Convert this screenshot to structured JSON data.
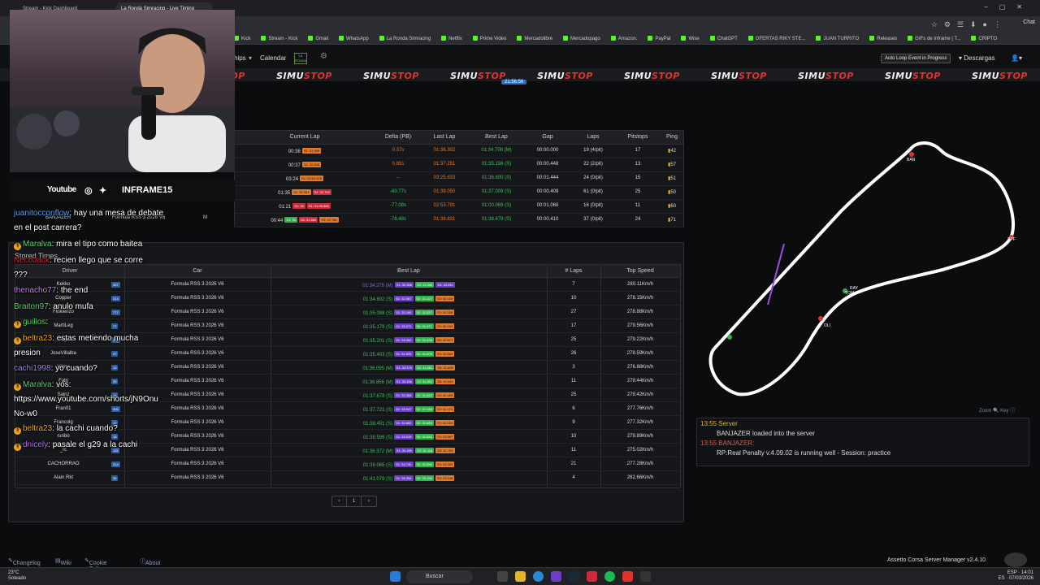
{
  "browser": {
    "tabs": [
      "Stream - Kick Dashboard",
      "La Ronda Simracing - Live Timing"
    ],
    "bookmarks": [
      "Kick",
      "Stream - Kick",
      "Gmail",
      "WhatsApp",
      "La Ronda Simracing",
      "Netflix",
      "Prime Video",
      "Mercadolibre",
      "Mercadopago",
      "Amazon.",
      "PayPal",
      "Wise",
      "ChatGPT",
      "OFERTAS RIKY STE...",
      "JUAN TURRITO",
      "Releases",
      "GIFs de Inframe | T...",
      "CRIPTO"
    ],
    "chat_label": "Chat"
  },
  "nav": {
    "partial_item": "hips",
    "calendar": "Calendar",
    "logo_text": "LA RONDA",
    "auto_loop": "Auto Loop Event in Progress",
    "downloads": "Descargas"
  },
  "sponsor": {
    "name_a": "SIMU",
    "name_b": "STOP"
  },
  "timer_chip": "21:56:56",
  "live_timing": {
    "headers": [
      "Current Lap",
      "Delta (PB)",
      "Last Lap",
      "Best Lap",
      "Gap",
      "Laps",
      "Pitstops",
      "Ping"
    ],
    "rows": [
      {
        "current": "00:36",
        "chips": [
          "S1: 31.598"
        ],
        "delta": "0.37s",
        "last": "01:36.302",
        "best": "01:34.708 (M)",
        "gap": "00:00.000",
        "laps": "19 (4/pit)",
        "pit": "17",
        "ping": "42"
      },
      {
        "current": "00:37",
        "chips": [
          "S1: 32.626"
        ],
        "delta": "0.65s",
        "last": "01:37.251",
        "best": "01:35.156 (S)",
        "gap": "00:00.448",
        "laps": "22 (2/pit)",
        "pit": "13",
        "ping": "57"
      },
      {
        "current": "03:24",
        "chips": [
          "S1: 03:03.926"
        ],
        "delta": "--",
        "last": "03:25.633",
        "best": "01:36.600 (S)",
        "gap": "00:01.444",
        "laps": "24 (0/pit)",
        "pit": "15",
        "ping": "51"
      },
      {
        "current": "01:35",
        "chips": [
          "S1: 30.333",
          "S2: 32.793"
        ],
        "delta": "-60.77s",
        "last": "01:39.050",
        "best": "01:37.009 (S)",
        "gap": "00:00.409",
        "laps": "61 (0/pit)",
        "pit": "25",
        "ping": "50"
      },
      {
        "current": "01:21",
        "chips": [
          "S1: 30",
          "S1: 01:00.606"
        ],
        "delta": "-77.08s",
        "last": "02:53.791",
        "best": "01:00.069 (S)",
        "gap": "00:01.060",
        "laps": "16 (0/pit)",
        "pit": "11",
        "ping": "60"
      },
      {
        "current": "00:44",
        "chips": [
          "S1: 30",
          "S2: 31.585",
          "S3: 42.786"
        ],
        "delta": "-78.48s",
        "last": "01:38.831",
        "best": "01:38.479 (S)",
        "gap": "00:00.410",
        "laps": "37 (0/pit)",
        "pit": "24",
        "ping": "71"
      }
    ],
    "left_partial": [
      {
        "driver": "BANJAZER",
        "car": "Formula RSS 3 2026 V6",
        "tyre": "M"
      }
    ]
  },
  "stored_times": {
    "title": "Stored Times",
    "headers": [
      "Driver",
      "Car",
      "Best Lap",
      "# Laps",
      "Top Speed"
    ],
    "rows": [
      {
        "driver": "Kekko",
        "num": "307",
        "car": "Formula RSS 3 2026 V6",
        "best": "01:34.276 (M)",
        "s": [
          "S1: 32.558",
          "S2: 31.065",
          "S3: 40.261"
        ],
        "laps": "7",
        "speed": "280.11Km/h"
      },
      {
        "driver": "Copper",
        "num": "314",
        "car": "Formula RSS 3 2026 V6",
        "best": "01:34.602 (S)",
        "s": [
          "S1: 32.987",
          "S2: 31.107",
          "S3: 40.428"
        ],
        "laps": "10",
        "speed": "278.15Km/h"
      },
      {
        "driver": "Flokienzo",
        "num": "777",
        "car": "Formula RSS 3 2026 V6",
        "best": "01:35.098 (S)",
        "s": [
          "S1: 33.195",
          "S2: 31.537",
          "S3: 40.336"
        ],
        "laps": "27",
        "speed": "278.88Km/h"
      },
      {
        "driver": "MartiLeg",
        "num": "77",
        "car": "Formula RSS 3 2026 V6",
        "best": "01:35.179 (S)",
        "s": [
          "S1: 33.071",
          "S2: 31.471",
          "S3: 40.433"
        ],
        "laps": "17",
        "speed": "279.56Km/h"
      },
      {
        "driver": "Ag",
        "num": "315",
        "car": "Formula RSS 3 2026 V6",
        "best": "01:35.201 (S)",
        "s": [
          "S1: 33.062",
          "S2: 31.428",
          "S3: 40.671"
        ],
        "laps": "25",
        "speed": "279.22Km/h"
      },
      {
        "driver": "JoseVillalba",
        "num": "47",
        "car": "Formula RSS 3 2026 V6",
        "best": "01:35.403 (S)",
        "s": [
          "S1: 32.935",
          "S2: 31.609",
          "S3: 40.869"
        ],
        "laps": "26",
        "speed": "278.59Km/h"
      },
      {
        "driver": "Vinny",
        "num": "10",
        "car": "Formula RSS 3 2026 V6",
        "best": "01:36.095 (M)",
        "s": [
          "S1: 33.575",
          "S2: 31.681",
          "S3: 41.839"
        ],
        "laps": "3",
        "speed": "276.88Km/h"
      },
      {
        "driver": "Fabi",
        "num": "39",
        "car": "Formula RSS 3 2026 V6",
        "best": "01:36.856 (M)",
        "s": [
          "S1: 33.456",
          "S2: 31.851",
          "S3: 41.549"
        ],
        "laps": "11",
        "speed": "278.44Km/h"
      },
      {
        "driver": "Sainz",
        "num": "14",
        "car": "Formula RSS 3 2026 V6",
        "best": "01:37.679 (S)",
        "s": [
          "S1: 33.368",
          "S2: 31.822",
          "S3: 42.489"
        ],
        "laps": "25",
        "speed": "278.42Km/h"
      },
      {
        "driver": "Fran01",
        "num": "306",
        "car": "Formula RSS 3 2026 V6",
        "best": "01:37.721 (S)",
        "s": [
          "S1: 33.947",
          "S2: 31.186",
          "S3: 41.474"
        ],
        "laps": "6",
        "speed": "277.76Km/h"
      },
      {
        "driver": "Francolg",
        "num": "12",
        "car": "Formula RSS 3 2026 V6",
        "best": "01:38.451 (S)",
        "s": [
          "S1: 33.852",
          "S2: 31.666",
          "S3: 42.534"
        ],
        "laps": "9",
        "speed": "277.32Km/h"
      },
      {
        "driver": "runbo",
        "num": "18",
        "car": "Formula RSS 3 2026 V6",
        "best": "01:38.599 (S)",
        "s": [
          "S1: 34.019",
          "S2: 31.583",
          "S3: 43.587"
        ],
        "laps": "10",
        "speed": "279.89Km/h"
      },
      {
        "driver": "_rc",
        "num": "115",
        "car": "Formula RSS 3 2026 V6",
        "best": "01:38.372 (M)",
        "s": [
          "S1: 34.490",
          "S2: 31.118",
          "S3: 42.764"
        ],
        "laps": "11",
        "speed": "275.02Km/h"
      },
      {
        "driver": "CACHORRAO",
        "num": "314",
        "car": "Formula RSS 3 2026 V6",
        "best": "01:39.085 (S)",
        "s": [
          "S1: 34.740",
          "S2: 31.990",
          "S3: 43.355"
        ],
        "laps": "21",
        "speed": "277.28Km/h"
      },
      {
        "driver": "Alain Rkt",
        "num": "35",
        "car": "Formula RSS 3 2026 V6",
        "best": "01:41.079 (S)",
        "s": [
          "S1: 35.306",
          "S2: 32.159",
          "S3: 43.648"
        ],
        "laps": "4",
        "speed": "262.66Km/h"
      }
    ],
    "pager": [
      "‹",
      "1",
      "›"
    ]
  },
  "map": {
    "labels": [
      "BAN",
      "SPF",
      "RAY",
      "TOM",
      "OLI"
    ],
    "zoom": "Zoom",
    "key": "Key"
  },
  "server_log": [
    {
      "time": "13:55",
      "who": "Server",
      "text": "BANJAZER loaded into the server"
    },
    {
      "time": "13:55",
      "who": "BANJAZER:",
      "text": "RP:Real Penalty v.4.09.02 is running well - Session: practice"
    }
  ],
  "stream_overlay": {
    "youtube": "Youtube",
    "handle": "INFRAME15",
    "chat": [
      {
        "user": "juanitocconflow",
        "text": ": hay una mesa de debate",
        "color": "#4aa3ff"
      },
      {
        "user": "",
        "text": "en el post carrera?",
        "color": "#fff"
      },
      {
        "user": "Maralva",
        "text": ": mira el tipo como baitea",
        "color": "#5ad36a",
        "badge": true
      },
      {
        "user": "NecoJack",
        "text": ": recien llego que se corre",
        "color": "#cc2b3a"
      },
      {
        "user": "",
        "text": "???",
        "color": "#fff"
      },
      {
        "user": "thenacho77",
        "text": ": the end",
        "color": "#c77ef0"
      },
      {
        "user": "Braiton97",
        "text": ": anulo mufa",
        "color": "#5ad36a"
      },
      {
        "user": "guillos",
        "text": ": ",
        "color": "#5ad36a",
        "badge": true
      },
      {
        "user": "beltra23",
        "text": ": estas metiendo mucha",
        "color": "#f0a420",
        "badge": true
      },
      {
        "user": "",
        "text": "presion",
        "color": "#fff"
      },
      {
        "user": "cachi1998",
        "text": ": yo cuando?",
        "color": "#a97ef0"
      },
      {
        "user": "Maralva",
        "text": ": vos:",
        "color": "#5ad36a",
        "badge": true
      },
      {
        "user": "",
        "text": "https://www.youtube.com/shorts/jN9Onu",
        "color": "#fff"
      },
      {
        "user": "",
        "text": "No-w0",
        "color": "#fff"
      },
      {
        "user": "beltra23",
        "text": ": la cachi cuando?",
        "color": "#f0a420",
        "badge": true
      },
      {
        "user": "dnicely",
        "text": ": pasale el g29 a la cachi",
        "color": "#b06ef0",
        "badge": true
      }
    ]
  },
  "footer": {
    "changelog": "Changelog",
    "wiki": "Wiki",
    "cookie": "Cookie Policy",
    "about": "About",
    "manager": "Assetto Corsa Server Manager v2.4.10"
  },
  "taskbar": {
    "temp": "23°C",
    "weather": "Soleado",
    "search": "Buscar",
    "lang": "ESP",
    "region": "ES",
    "time": "14:01",
    "date": "07/03/2026"
  }
}
